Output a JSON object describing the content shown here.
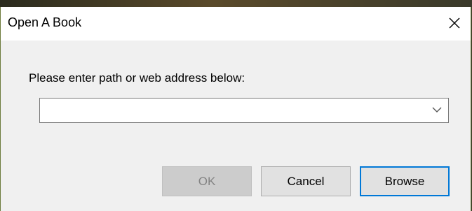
{
  "window": {
    "title": "Open A Book"
  },
  "prompt": {
    "text": "Please enter path or web address below:"
  },
  "path_combo": {
    "value": "",
    "placeholder": ""
  },
  "buttons": {
    "ok_label": "OK",
    "cancel_label": "Cancel",
    "browse_label": "Browse"
  },
  "icons": {
    "close": "close-icon",
    "dropdown": "chevron-down-icon"
  },
  "colors": {
    "dialog_bg": "#f0f0f0",
    "titlebar_bg": "#ffffff",
    "default_button_border": "#0078d7",
    "disabled_text": "#838383"
  }
}
